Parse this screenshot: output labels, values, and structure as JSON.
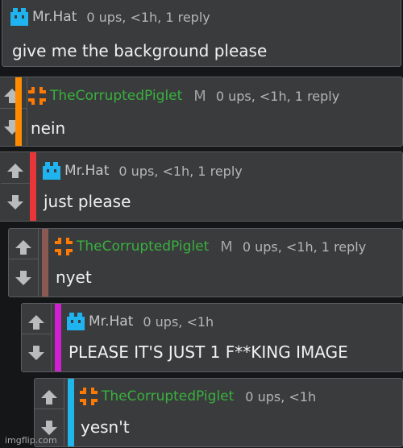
{
  "comments": [
    {
      "user": "Mr.Hat",
      "badge": "",
      "meta": "0 ups, <1h, 1 reply",
      "text": "give me the background please",
      "avatar_icon": "mr-hat-avatar-icon",
      "bar_color": ""
    },
    {
      "user": "TheCorruptedPiglet",
      "badge": "M",
      "meta": "0 ups, <1h, 1 reply",
      "text": "nein",
      "avatar_icon": "piglet-avatar-icon",
      "bar_color": "#ff8c00"
    },
    {
      "user": "Mr.Hat",
      "badge": "",
      "meta": "0 ups, <1h, 1 reply",
      "text": "just please",
      "avatar_icon": "mr-hat-avatar-icon",
      "bar_color": "#e8353a"
    },
    {
      "user": "TheCorruptedPiglet",
      "badge": "M",
      "meta": "0 ups, <1h, 1 reply",
      "text": "nyet",
      "avatar_icon": "piglet-avatar-icon",
      "bar_color": "#8a5a52"
    },
    {
      "user": "Mr.Hat",
      "badge": "",
      "meta": "0 ups, <1h",
      "text": "PLEASE IT'S JUST 1 F**KING IMAGE",
      "avatar_icon": "mr-hat-avatar-icon",
      "bar_color": "#d21fd2"
    },
    {
      "user": "TheCorruptedPiglet",
      "badge": "",
      "meta": "0 ups, <1h",
      "text": "yesn't",
      "avatar_icon": "piglet-avatar-icon",
      "bar_color": "#1fb6ea"
    }
  ],
  "colors": {
    "mrhat_avatar": "#1fb4f0",
    "piglet_avatar": "#ff7a00",
    "username_green": "#39b03e"
  },
  "icons": {
    "upvote": "arrow-up-icon",
    "downvote": "arrow-down-icon"
  },
  "watermark": "imgflip.com"
}
